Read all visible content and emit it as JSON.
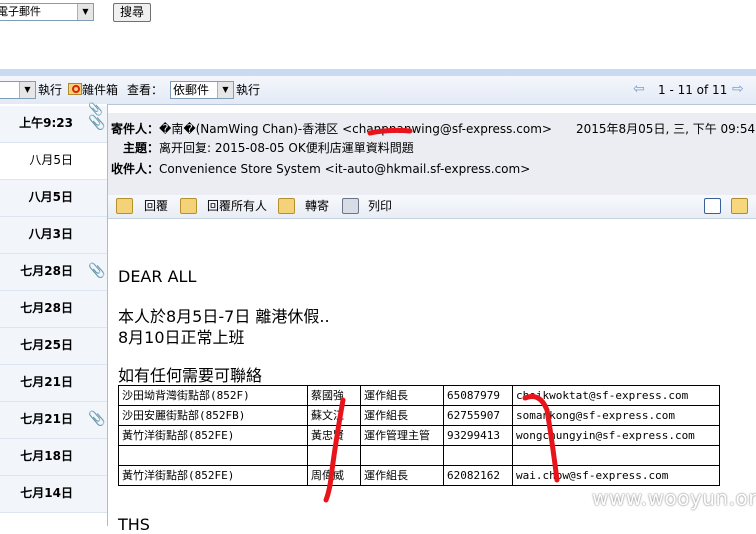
{
  "search": {
    "folder_value": "電子郵件",
    "button_label": "搜尋"
  },
  "toolbar": {
    "move_value": "",
    "execute_label_1": "執行",
    "junk_label": "雜件箱",
    "view_label": "查看：",
    "sort_value": "依郵件",
    "execute_label_2": "執行",
    "paging": "1 - 11 of 11"
  },
  "message_list": [
    {
      "date": "上午9:23",
      "bold": true,
      "attachment": true
    },
    {
      "date": "八月5日",
      "bold": false,
      "attachment": false
    },
    {
      "date": "八月5日",
      "bold": true,
      "attachment": false
    },
    {
      "date": "八月3日",
      "bold": true,
      "attachment": false
    },
    {
      "date": "七月28日",
      "bold": true,
      "attachment": true
    },
    {
      "date": "七月28日",
      "bold": true,
      "attachment": false
    },
    {
      "date": "七月25日",
      "bold": true,
      "attachment": false
    },
    {
      "date": "七月21日",
      "bold": true,
      "attachment": false
    },
    {
      "date": "七月21日",
      "bold": true,
      "attachment": true
    },
    {
      "date": "七月18日",
      "bold": true,
      "attachment": false
    },
    {
      "date": "七月14日",
      "bold": true,
      "attachment": false
    }
  ],
  "header": {
    "from_label": "寄件人：",
    "from_value": "�南�(NamWing Chan)-香港区 <chanpnanwing@sf-express.com>",
    "date_value": "2015年8月05日, 三, 下午 09:54",
    "subject_label": "主題：",
    "subject_value": "离开回复: 2015-08-05 OK便利店運單資料問題",
    "to_label": "收件人：",
    "to_value": "Convenience Store System <it-auto@hkmail.sf-express.com>"
  },
  "actions": {
    "reply": "回覆",
    "reply_all": "回覆所有人",
    "forward": "轉寄",
    "print": "列印"
  },
  "body": {
    "greeting": "DEAR ALL",
    "line1": "本人於8月5日-7日  離港休假..",
    "line2": "8月10日正常上班",
    "line3": "如有任何需要可聯絡",
    "signoff": "THS"
  },
  "contacts": [
    [
      "沙田坳背灣街點部(852F)",
      "蔡國強",
      "運作組長",
      "65087979",
      "choikwoktat@sf-express.com"
    ],
    [
      "沙田安麗街點部(852FB)",
      "蘇文江",
      "運作組長",
      "62755907",
      "somankong@sf-express.com"
    ],
    [
      "黃竹洋街點部(852FE)",
      "黃忠賢",
      "運作管理主管",
      "93299413",
      "wongchungyin@sf-express.com"
    ],
    [
      "",
      "",
      "",
      "",
      ""
    ],
    [
      "黃竹洋街點部(852FE)",
      "周偉威",
      "運作組長",
      "62082162",
      "wai.chow@sf-express.com"
    ]
  ],
  "watermark": "www.wooyun.org",
  "colors": {
    "header_bg": "#ebedf2",
    "toolbar_strip": "#c9dbf1",
    "redaction": "#e8141b"
  }
}
